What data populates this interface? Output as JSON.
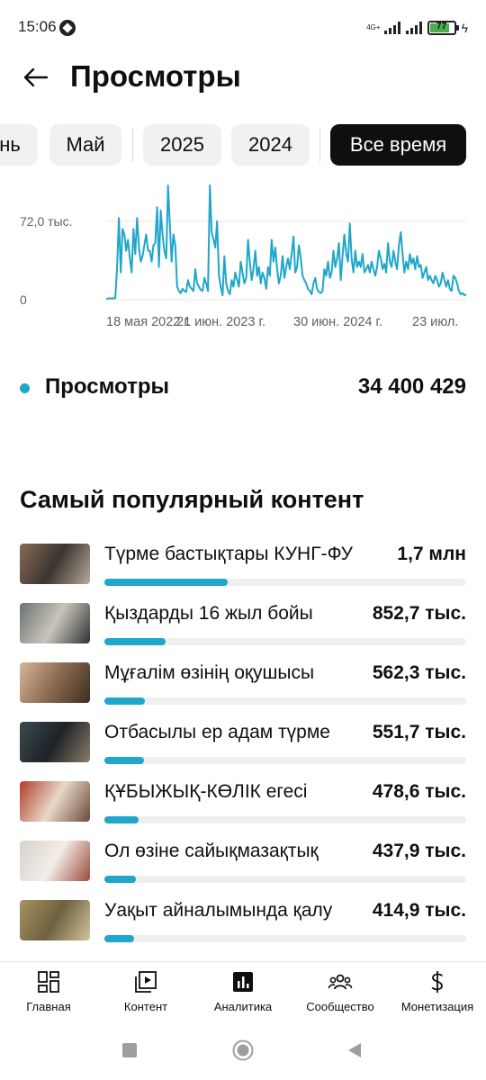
{
  "status_bar": {
    "time": "15:06",
    "network_label": "4G+",
    "battery_level": "77",
    "battery_color": "#4caf50"
  },
  "header": {
    "title": "Просмотры",
    "back_icon": "arrow-left-icon"
  },
  "period_chips": [
    {
      "label": "нь",
      "selected": false
    },
    {
      "label": "Май",
      "selected": false
    },
    {
      "label": "2025",
      "selected": false
    },
    {
      "label": "2024",
      "selected": false
    },
    {
      "label": "Все время",
      "selected": true
    }
  ],
  "chart_data": {
    "type": "line",
    "series": [
      {
        "values": [
          500,
          1000,
          1500,
          1000,
          1500,
          1500,
          30000,
          75000,
          25000,
          65000,
          60000,
          45000,
          55000,
          38000,
          25000,
          65000,
          42000,
          75000,
          48000,
          35000,
          40000,
          50000,
          60000,
          45000,
          45000,
          35000,
          50000,
          52000,
          85000,
          30000,
          82000,
          60000,
          45000,
          38000,
          105000,
          70000,
          35000,
          60000,
          50000,
          12000,
          8000,
          6000,
          10000,
          8000,
          7000,
          18000,
          12000,
          10000,
          8000,
          28000,
          15000,
          12000,
          9000,
          8000,
          20000,
          15000,
          8000,
          105000,
          62000,
          55000,
          48000,
          72000,
          22000,
          12000,
          4000,
          40000,
          15000,
          8000,
          5000,
          18000,
          12000,
          25000,
          18000,
          12000,
          35000,
          25000,
          15000,
          20000,
          55000,
          35000,
          18000,
          28000,
          45000,
          22000,
          30000,
          15000,
          25000,
          20000,
          10000,
          30000,
          22000,
          55000,
          35000,
          48000,
          28000,
          15000,
          22000,
          40000,
          20000,
          30000,
          38000,
          28000,
          42000,
          58000,
          25000,
          30000,
          50000,
          38000,
          22000,
          18000,
          15000,
          10000,
          8000,
          5000,
          15000,
          20000,
          10000,
          7000,
          6000,
          8000,
          28000,
          22000,
          35000,
          20000,
          25000,
          45000,
          30000,
          38000,
          52000,
          18000,
          40000,
          60000,
          42000,
          35000,
          70000,
          38000,
          25000,
          45000,
          30000,
          35000,
          30000,
          42000,
          25000,
          28000,
          32000,
          25000,
          35000,
          28000,
          22000,
          30000,
          45000,
          38000,
          28000,
          33000,
          25000,
          52000,
          35000,
          30000,
          45000,
          35000,
          28000,
          50000,
          62000,
          42000,
          25000,
          35000,
          28000,
          42000,
          33000,
          38000,
          28000,
          40000,
          30000,
          32000,
          20000,
          25000,
          30000,
          18000,
          22000,
          18000,
          15000,
          22000,
          18000,
          12000,
          15000,
          25000,
          18000,
          12000,
          18000,
          10000,
          8000,
          22000,
          20000,
          15000,
          8000,
          5000,
          6000,
          4000,
          5000
        ],
        "color": "#1fa6c9"
      }
    ],
    "x_tick_labels": [
      "18 мая 2022 г.",
      "21 июн. 2023 г.",
      "30 июн. 2024 г.",
      "23 июл."
    ],
    "y_tick_labels": [
      "72,0 тыс.",
      "0"
    ],
    "y_ticks": [
      72000,
      0
    ],
    "ylim": [
      0,
      110000
    ],
    "grid": "horizontal"
  },
  "summary": {
    "label": "Просмотры",
    "value": "34 400 429",
    "dot_color": "#1fa6c9"
  },
  "popular": {
    "title": "Самый популярный контент",
    "items": [
      {
        "title": "Түрме бастықтары КУНГ-ФУ",
        "value": "1,7 млн",
        "share": 0.34,
        "thumb": [
          "#8a6a55",
          "#3a3530",
          "#b8a89a"
        ]
      },
      {
        "title": "Қыздарды 16 жыл бойы",
        "value": "852,7 тыс.",
        "share": 0.17,
        "thumb": [
          "#6a7470",
          "#c9c4bb",
          "#2e3331"
        ]
      },
      {
        "title": "Мұғалім өзінің оқушысы",
        "value": "562,3 тыс.",
        "share": 0.112,
        "thumb": [
          "#d7b59a",
          "#8a6b50",
          "#3b2c22"
        ]
      },
      {
        "title": "Отбасылы ер адам түрме",
        "value": "551,7 тыс.",
        "share": 0.11,
        "thumb": [
          "#3d4a52",
          "#1d2226",
          "#8a7c6a"
        ]
      },
      {
        "title": "ҚҰБЫЖЫҚ-КӨЛІК егесі",
        "value": "478,6 тыс.",
        "share": 0.095,
        "thumb": [
          "#b23d2a",
          "#e8d8c8",
          "#6b4a3a"
        ]
      },
      {
        "title": "Ол өзіне сайықмазақтық",
        "value": "437,9 тыс.",
        "share": 0.087,
        "thumb": [
          "#d9d2cc",
          "#f2ede8",
          "#9b4a3a"
        ]
      },
      {
        "title": "Уақыт айналымында қалу",
        "value": "414,9 тыс.",
        "share": 0.083,
        "thumb": [
          "#a8935f",
          "#6e6140",
          "#d2c39a"
        ]
      }
    ]
  },
  "bottom_nav": [
    {
      "label": "Главная",
      "icon": "dashboard-icon"
    },
    {
      "label": "Контент",
      "icon": "video-library-icon"
    },
    {
      "label": "Аналитика",
      "icon": "analytics-icon",
      "selected": true
    },
    {
      "label": "Сообщество",
      "icon": "community-icon"
    },
    {
      "label": "Монетизация",
      "icon": "dollar-icon"
    }
  ]
}
